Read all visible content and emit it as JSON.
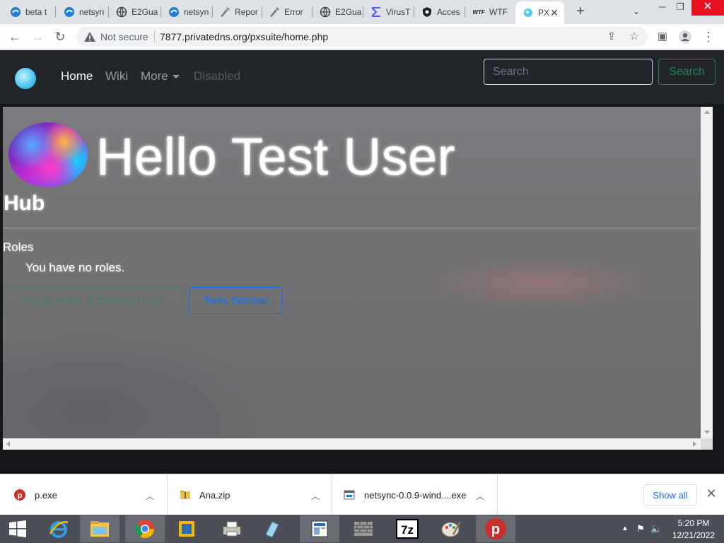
{
  "browser": {
    "tabs": [
      {
        "title": "beta t",
        "icon": "edge-style-icon"
      },
      {
        "title": "netsyn",
        "icon": "edge-style-icon"
      },
      {
        "title": "E2Gua",
        "icon": "globe-icon"
      },
      {
        "title": "netsyn",
        "icon": "edge-style-icon"
      },
      {
        "title": "Repor",
        "icon": "pen-icon"
      },
      {
        "title": "Error",
        "icon": "pen-icon"
      },
      {
        "title": "E2Gua",
        "icon": "globe-icon"
      },
      {
        "title": "VirusT",
        "icon": "virustotal-icon"
      },
      {
        "title": "Acces",
        "icon": "shield-icon"
      },
      {
        "title": "WTF",
        "icon": "wtf-icon",
        "badge": "WTF"
      },
      {
        "title": "PX",
        "icon": "pxsuite-icon",
        "active": true
      }
    ],
    "not_secure_label": "Not secure",
    "url": "7877.privatedns.org/pxsuite/home.php"
  },
  "navbar": {
    "links": [
      {
        "label": "Home",
        "state": "active"
      },
      {
        "label": "Wiki",
        "state": "normal"
      },
      {
        "label": "More",
        "state": "dropdown"
      },
      {
        "label": "Disabled",
        "state": "disabled"
      }
    ],
    "search_placeholder": "Search",
    "search_button": "Search"
  },
  "main": {
    "greeting": "Hello Test User",
    "section_title": "Hub",
    "roles_title": "Roles",
    "roles_empty": "You have no roles.",
    "buttons": {
      "green_faint": "Toggle Roles & Settings Panel",
      "tools_button": "Tools Sidebar"
    }
  },
  "downloads": {
    "items": [
      {
        "name": "p.exe",
        "icon": "pcloud-p-icon"
      },
      {
        "name": "Ana.zip",
        "icon": "zip-folder-icon"
      },
      {
        "name": "netsync-0.0.9-wind....exe",
        "icon": "installer-icon"
      }
    ],
    "show_all": "Show all"
  },
  "taskbar": {
    "time": "5:20 PM",
    "date": "12/21/2022"
  },
  "colors": {
    "navbar_bg": "#212529",
    "search_green": "#198754",
    "tools_blue": "#0d6efd",
    "close_red": "#e81123"
  }
}
